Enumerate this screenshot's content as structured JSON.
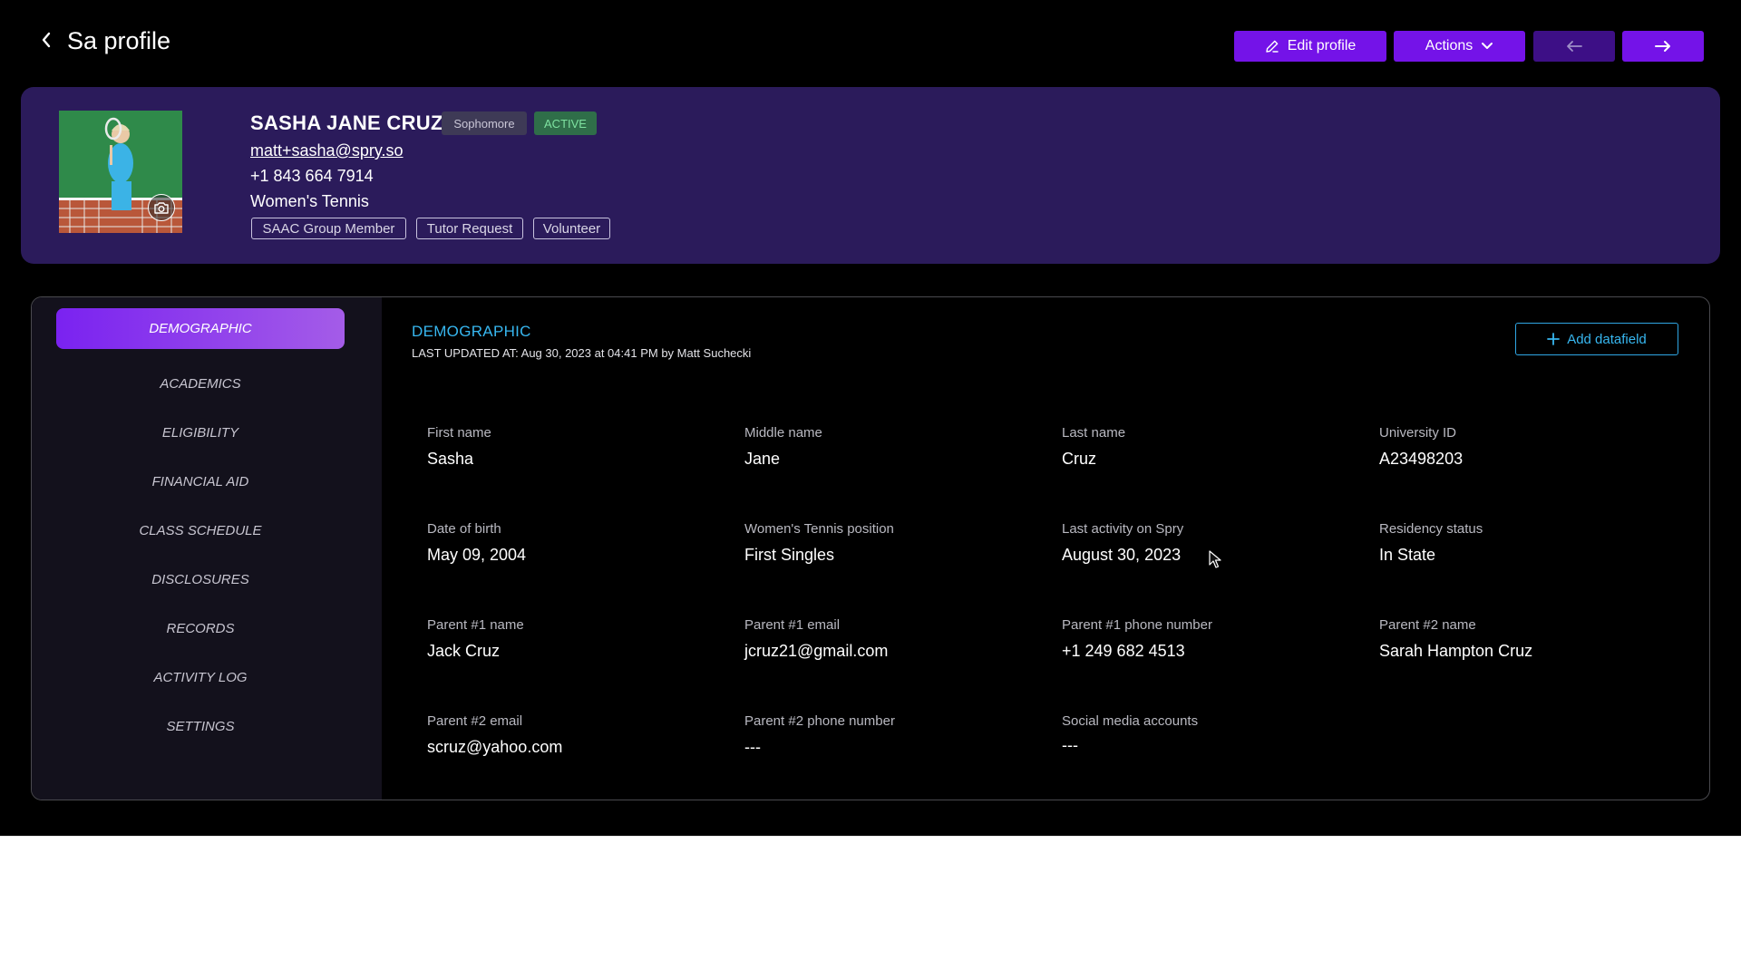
{
  "header": {
    "title": "Sa profile",
    "edit_label": "Edit profile",
    "actions_label": "Actions"
  },
  "profile": {
    "name": "SASHA JANE CRUZ",
    "year_badge": "Sophomore",
    "status_badge": "ACTIVE",
    "email": "matt+sasha@spry.so",
    "phone": "+1 843 664 7914",
    "sport": "Women's Tennis",
    "tags": [
      "SAAC Group Member",
      "Tutor Request",
      "Volunteer"
    ]
  },
  "nav": {
    "active": "DEMOGRAPHIC",
    "items": [
      "ACADEMICS",
      "ELIGIBILITY",
      "FINANCIAL AID",
      "CLASS SCHEDULE",
      "DISCLOSURES",
      "RECORDS",
      "ACTIVITY LOG",
      "SETTINGS"
    ]
  },
  "section": {
    "title": "DEMOGRAPHIC",
    "updated": "LAST UPDATED AT: Aug 30, 2023 at 04:41 PM by Matt Suchecki",
    "add_label": "Add datafield"
  },
  "fields": [
    {
      "label": "First name",
      "value": "Sasha"
    },
    {
      "label": "Middle name",
      "value": "Jane"
    },
    {
      "label": "Last name",
      "value": "Cruz"
    },
    {
      "label": "University ID",
      "value": "A23498203"
    },
    {
      "label": "Date of birth",
      "value": "May 09, 2004"
    },
    {
      "label": "Women's Tennis position",
      "value": "First Singles"
    },
    {
      "label": "Last activity on Spry",
      "value": "August 30, 2023"
    },
    {
      "label": "Residency status",
      "value": "In State"
    },
    {
      "label": "Parent #1 name",
      "value": "Jack Cruz"
    },
    {
      "label": "Parent #1 email",
      "value": "jcruz21@gmail.com"
    },
    {
      "label": "Parent #1 phone number",
      "value": "+1 249 682 4513"
    },
    {
      "label": "Parent #2 name",
      "value": "Sarah Hampton Cruz"
    },
    {
      "label": "Parent #2 email",
      "value": "scruz@yahoo.com"
    },
    {
      "label": "Parent #2 phone number",
      "value": "---"
    },
    {
      "label": "Social media accounts",
      "value": "---"
    }
  ],
  "colors": {
    "accent": "#7413e8",
    "card_bg": "#2b1b5b",
    "link_blue": "#37b7f0",
    "active_green": "#7ee2a0"
  }
}
